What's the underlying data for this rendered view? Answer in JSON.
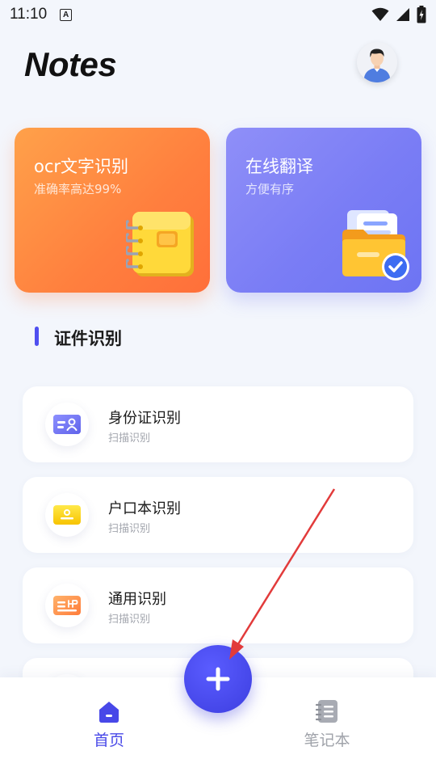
{
  "status_bar": {
    "time": "11:10",
    "notification_letter": "A"
  },
  "header": {
    "title": "Notes"
  },
  "feature_cards": [
    {
      "title": "ocr文字识别",
      "subtitle": "准确率高达99%"
    },
    {
      "title": "在线翻译",
      "subtitle": "方便有序"
    }
  ],
  "section": {
    "title": "证件识别"
  },
  "list_items": [
    {
      "title": "身份证识别",
      "subtitle": "扫描识别"
    },
    {
      "title": "户口本识别",
      "subtitle": "扫描识别"
    },
    {
      "title": "通用识别",
      "subtitle": "扫描识别"
    }
  ],
  "bottom_nav": {
    "items": [
      {
        "label": "首页"
      },
      {
        "label": "笔记本"
      }
    ]
  },
  "colors": {
    "accent": "#4848e8",
    "ocr_card": "#ff8a40",
    "translate_card": "#7c80f6",
    "annotation_arrow": "#e23b3b"
  }
}
